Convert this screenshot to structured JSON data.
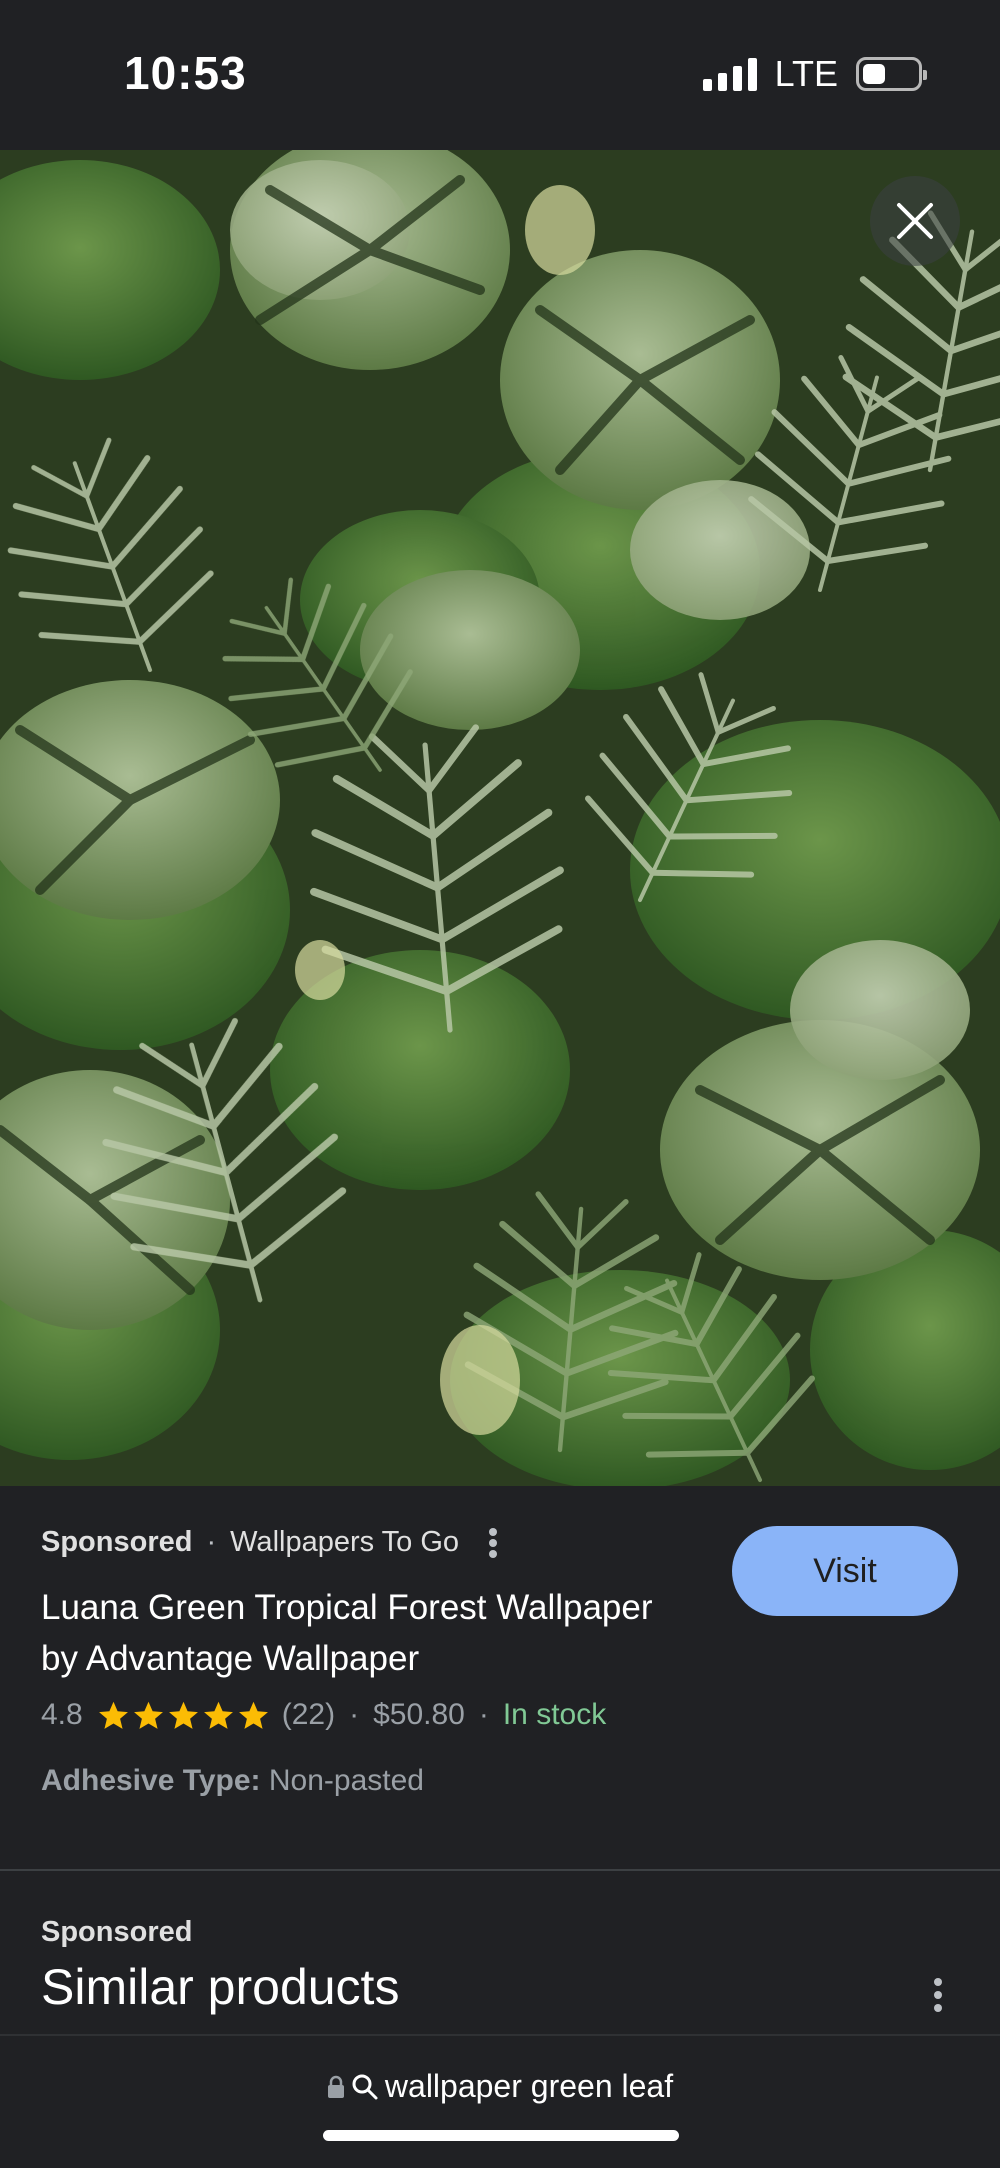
{
  "status_bar": {
    "time": "10:53",
    "network": "LTE"
  },
  "hero": {
    "close_icon": "close-icon"
  },
  "product": {
    "sponsored_label": "Sponsored",
    "separator": "·",
    "seller": "Wallpapers To Go",
    "title": "Luana Green Tropical Forest Wallpaper by Advantage Wallpaper",
    "visit_label": "Visit",
    "rating": "4.8",
    "stars": 5,
    "review_count": "(22)",
    "price": "$50.80",
    "availability": "In stock",
    "attribute_key": "Adhesive Type:",
    "attribute_value": "Non-pasted"
  },
  "similar": {
    "sponsored_label": "Sponsored",
    "title": "Similar products"
  },
  "url_bar": {
    "query": "wallpaper green leaf"
  },
  "colors": {
    "background": "#202124",
    "accent": "#8ab4f8",
    "in_stock": "#81c995",
    "star": "#fbbc04"
  }
}
